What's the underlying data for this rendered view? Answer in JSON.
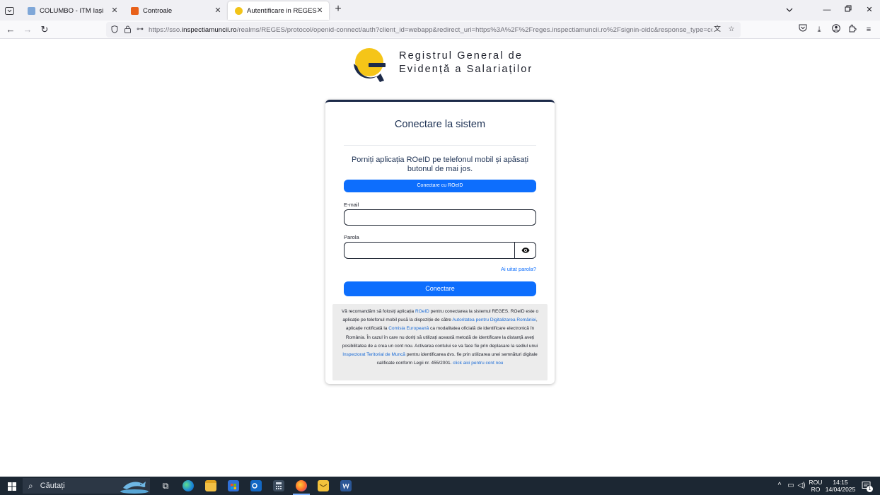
{
  "browser": {
    "tabs": [
      {
        "title": "COLUMBO - ITM Iași",
        "favicon_color": "#7fa7d8",
        "active": false
      },
      {
        "title": "Controale",
        "favicon_color": "#e8611a",
        "active": false
      },
      {
        "title": "Autentificare in REGES",
        "favicon_color": "#f2c419",
        "active": true
      }
    ],
    "url_prefix": "https://sso.",
    "url_domain": "inspectiamuncii.ro",
    "url_rest": "/realms/REGES/protocol/openid-connect/auth?client_id=webapp&redirect_uri=https%3A%2F%2Freges.inspectiamuncii.ro%2Fsignin-oidc&response_type=code&scope=openid"
  },
  "page": {
    "brand_line1": "Registrul General de",
    "brand_line2": "Evidență a Salariaților",
    "card_title": "Conectare la sistem",
    "instruction": "Porniți aplicația ROeID pe telefonul mobil și apăsați butonul de mai jos.",
    "roeid_button": "Conectare cu ROeID",
    "email_label": "E-mail",
    "password_label": "Parola",
    "forgot_link": "Ai uitat parola?",
    "login_button": "Conectare",
    "info": {
      "t1": "Vă recomandăm să folosiți aplicația ",
      "l1": "ROeID",
      "t2": " pentru conectarea la sistemul REGES. ROeID este o aplicație pe telefonul mobil pusă la dispoziție de către ",
      "l2": "Autoritatea pentru Digitalizarea României",
      "t3": ", aplicație notificată la ",
      "l3": "Comisia Europeană",
      "t4": " ca modalitatea oficială de identificare electronică în România. În cazul în care nu doriți să utilizați această metodă de identificare la distanță aveți posibilitatea de a crea un cont nou. Activarea contului se va face fie prin deplasare la sediul unui ",
      "l4": "Inspectorat Teritorial de Muncă",
      "t5": " pentru identificarea dvs. fie prin utilizarea unei semnături digitale calificate conform Legii nr. 455/2001. ",
      "l5": "click aici pentru cont nou"
    }
  },
  "taskbar": {
    "search_placeholder": "Căutați",
    "lang_top": "ROU",
    "lang_bottom": "RO",
    "time": "14:15",
    "date": "14/04/2025",
    "notification_count": "1"
  },
  "colors": {
    "primary_button": "#0d6efd",
    "card_accent": "#1c2a49",
    "logo_yellow": "#f5c518",
    "logo_navy": "#1c2a49"
  }
}
